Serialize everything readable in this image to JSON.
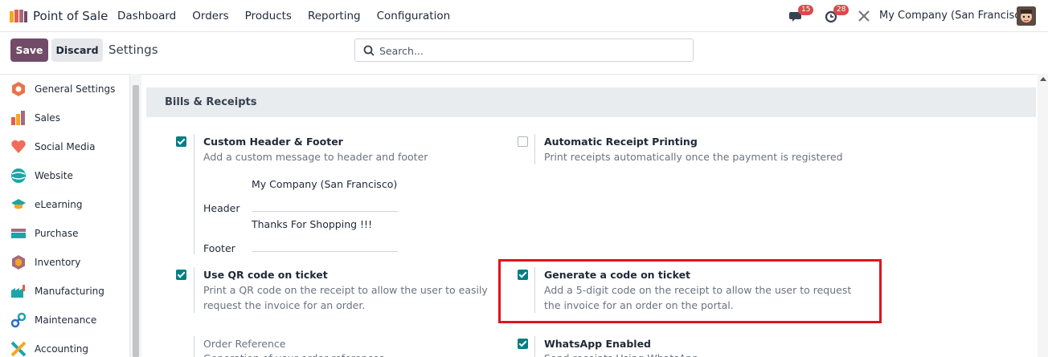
{
  "topnav": {
    "app_name": "Point of Sale",
    "menu": [
      "Dashboard",
      "Orders",
      "Products",
      "Reporting",
      "Configuration"
    ],
    "messages_count": "15",
    "activities_count": "28",
    "company": "My Company (San Francisco)"
  },
  "control": {
    "save_label": "Save",
    "discard_label": "Discard",
    "title": "Settings",
    "search_placeholder": "Search..."
  },
  "sidebar": {
    "items": [
      {
        "label": "General Settings",
        "icon": "general-settings-icon"
      },
      {
        "label": "Sales",
        "icon": "sales-icon"
      },
      {
        "label": "Social Media",
        "icon": "social-media-icon"
      },
      {
        "label": "Website",
        "icon": "website-icon"
      },
      {
        "label": "eLearning",
        "icon": "elearning-icon"
      },
      {
        "label": "Purchase",
        "icon": "purchase-icon"
      },
      {
        "label": "Inventory",
        "icon": "inventory-icon"
      },
      {
        "label": "Manufacturing",
        "icon": "manufacturing-icon"
      },
      {
        "label": "Maintenance",
        "icon": "maintenance-icon"
      },
      {
        "label": "Accounting",
        "icon": "accounting-icon"
      }
    ]
  },
  "section": {
    "title": "Bills & Receipts",
    "custom_header": {
      "title": "Custom Header & Footer",
      "desc": "Add a custom message to header and footer",
      "checked": true,
      "header_label": "Header",
      "header_value": "My Company (San Francisco)",
      "footer_label": "Footer",
      "footer_value": "Thanks For Shopping !!!"
    },
    "auto_print": {
      "title": "Automatic Receipt Printing",
      "desc": "Print receipts automatically once the payment is registered",
      "checked": false
    },
    "qr_code": {
      "title": "Use QR code on ticket",
      "desc1": "Print a QR code on the receipt to allow the user to easily",
      "desc2": "request the invoice for an order.",
      "checked": true
    },
    "gen_code": {
      "title": "Generate a code on ticket",
      "desc1": "Add a 5-digit code on the receipt to allow the user to request",
      "desc2": "the invoice for an order on the portal.",
      "checked": true
    },
    "order_ref": {
      "title": "Order Reference",
      "desc": "Generation of your order references"
    },
    "whatsapp": {
      "title": "WhatsApp Enabled",
      "desc": "Send receipts Using WhatsApp",
      "checked": true
    }
  },
  "colors": {
    "brand": "#714b67",
    "checkbox": "#017e84",
    "badge": "#d94a4a",
    "highlight": "#e0141e"
  }
}
